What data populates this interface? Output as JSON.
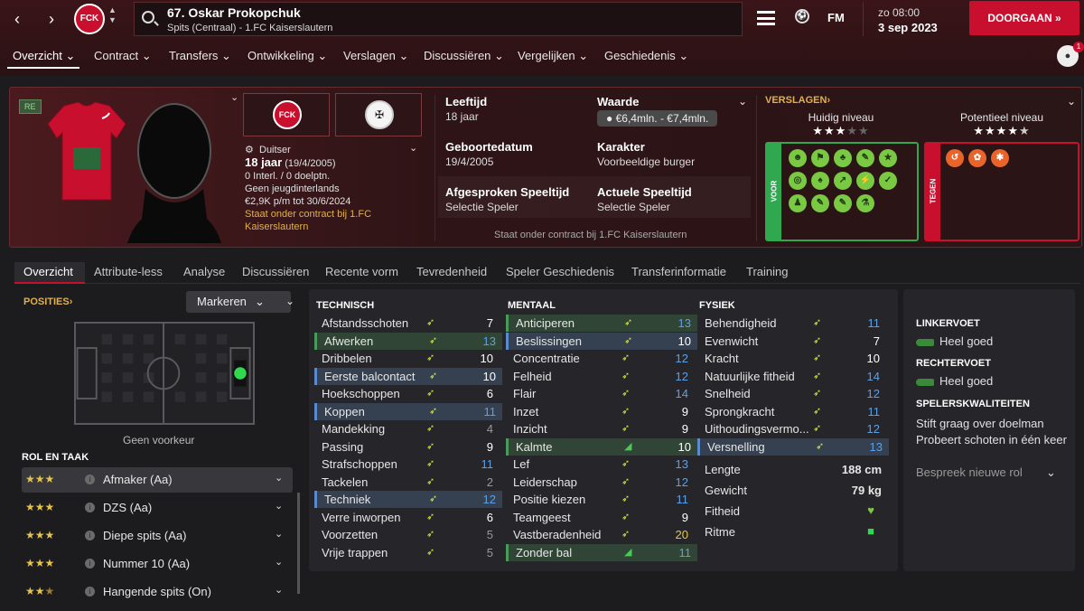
{
  "header": {
    "player_title": "67. Oskar Prokopchuk",
    "player_sub": "Spits (Centraal) - 1.FC Kaiserslautern",
    "club_badge": "FCK",
    "fm_label": "FM",
    "date_line1": "zo 08:00",
    "date_line2": "3 sep 2023",
    "continue_label": "DOORGAAN",
    "notif_count": "1"
  },
  "menu": [
    "Overzicht",
    "Contract",
    "Transfers",
    "Ontwikkeling",
    "Verslagen",
    "Discussiëren",
    "Vergelijken",
    "Geschiedenis"
  ],
  "hero": {
    "tag": "RE",
    "nationality": "Duitser",
    "age_line": "18 jaar",
    "dob_paren": "(19/4/2005)",
    "caps": "0 Interl. / 0 doelptn.",
    "youth": "Geen jeugdinterlands",
    "wage": "€2,9K p/m tot 30/6/2024",
    "contract_note": "Staat onder contract bij 1.FC Kaiserslautern",
    "leeftijd_k": "Leeftijd",
    "leeftijd_v": "18 jaar",
    "waarde_k": "Waarde",
    "waarde_v": "€6,4mln. - €7,4mln.",
    "geboorte_k": "Geboortedatum",
    "geboorte_v": "19/4/2005",
    "karakter_k": "Karakter",
    "karakter_v": "Voorbeeldige burger",
    "afgesproken_k": "Afgesproken Speeltijd",
    "afgesproken_v": "Selectie Speler",
    "actuele_k": "Actuele Speeltijd",
    "actuele_v": "Selectie Speler",
    "footer": "Staat onder contract bij 1.FC Kaiserslautern",
    "verslagen": "VERSLAGEN",
    "huidig": "Huidig niveau",
    "huidig_stars": 3,
    "potentieel": "Potentieel niveau",
    "potentieel_stars": 4.5,
    "voor": "VOOR",
    "tegen": "TEGEN"
  },
  "subtabs": [
    "Overzicht",
    "Attribute-less",
    "Analyse",
    "Discussiëren",
    "Recente vorm",
    "Tevredenheid",
    "Speler Geschiedenis",
    "Transferinformatie",
    "Training"
  ],
  "left": {
    "posities": "POSITIES",
    "markeren": "Markeren",
    "geen_voorkeur": "Geen voorkeur",
    "rol_en_taak": "ROL EN TAAK",
    "roles": [
      {
        "name": "Afmaker (Aa)",
        "stars": 3
      },
      {
        "name": "DZS (Aa)",
        "stars": 3
      },
      {
        "name": "Diepe spits (Aa)",
        "stars": 3
      },
      {
        "name": "Nummer 10 (Aa)",
        "stars": 3
      },
      {
        "name": "Hangende spits (On)",
        "stars": 2.5
      }
    ]
  },
  "attributes": {
    "technisch_label": "TECHNISCH",
    "mentaal_label": "MENTAAL",
    "fysiek_label": "FYSIEK",
    "technisch": [
      {
        "n": "Afstandsschoten",
        "v": 7,
        "h": ""
      },
      {
        "n": "Afwerken",
        "v": 13,
        "h": "g"
      },
      {
        "n": "Dribbelen",
        "v": 10,
        "h": ""
      },
      {
        "n": "Eerste balcontact",
        "v": 10,
        "h": "b"
      },
      {
        "n": "Hoekschoppen",
        "v": 6,
        "h": ""
      },
      {
        "n": "Koppen",
        "v": 11,
        "h": "b"
      },
      {
        "n": "Mandekking",
        "v": 4,
        "h": ""
      },
      {
        "n": "Passing",
        "v": 9,
        "h": ""
      },
      {
        "n": "Strafschoppen",
        "v": 11,
        "h": ""
      },
      {
        "n": "Tackelen",
        "v": 2,
        "h": ""
      },
      {
        "n": "Techniek",
        "v": 12,
        "h": "b"
      },
      {
        "n": "Verre inworpen",
        "v": 6,
        "h": ""
      },
      {
        "n": "Voorzetten",
        "v": 5,
        "h": ""
      },
      {
        "n": "Vrije trappen",
        "v": 5,
        "h": ""
      }
    ],
    "mentaal": [
      {
        "n": "Anticiperen",
        "v": 13,
        "h": "g"
      },
      {
        "n": "Beslissingen",
        "v": 10,
        "h": "b"
      },
      {
        "n": "Concentratie",
        "v": 12,
        "h": ""
      },
      {
        "n": "Felheid",
        "v": 12,
        "h": ""
      },
      {
        "n": "Flair",
        "v": 14,
        "h": ""
      },
      {
        "n": "Inzet",
        "v": 9,
        "h": ""
      },
      {
        "n": "Inzicht",
        "v": 9,
        "h": ""
      },
      {
        "n": "Kalmte",
        "v": 10,
        "h": "g"
      },
      {
        "n": "Lef",
        "v": 13,
        "h": ""
      },
      {
        "n": "Leiderschap",
        "v": 12,
        "h": ""
      },
      {
        "n": "Positie kiezen",
        "v": 11,
        "h": ""
      },
      {
        "n": "Teamgeest",
        "v": 9,
        "h": ""
      },
      {
        "n": "Vastberadenheid",
        "v": 20,
        "h": ""
      },
      {
        "n": "Zonder bal",
        "v": 11,
        "h": "g"
      }
    ],
    "fysiek": [
      {
        "n": "Behendigheid",
        "v": 11,
        "h": ""
      },
      {
        "n": "Evenwicht",
        "v": 7,
        "h": ""
      },
      {
        "n": "Kracht",
        "v": 10,
        "h": ""
      },
      {
        "n": "Natuurlijke fitheid",
        "v": 14,
        "h": ""
      },
      {
        "n": "Snelheid",
        "v": 12,
        "h": ""
      },
      {
        "n": "Sprongkracht",
        "v": 11,
        "h": ""
      },
      {
        "n": "Uithoudingsvermo...",
        "v": 12,
        "h": ""
      },
      {
        "n": "Versnelling",
        "v": 13,
        "h": "b"
      }
    ],
    "lengte_k": "Lengte",
    "lengte_v": "188 cm",
    "gewicht_k": "Gewicht",
    "gewicht_v": "79 kg",
    "fitheid_k": "Fitheid",
    "ritme_k": "Ritme"
  },
  "right": {
    "linkervoet_k": "LINKERVOET",
    "linkervoet_v": "Heel goed",
    "rechtervoet_k": "RECHTERVOET",
    "rechtervoet_v": "Heel goed",
    "kwal_k": "SPELERSKWALITEITEN",
    "kwal_1": "Stift graag over doelman",
    "kwal_2": "Probeert schoten in één keer",
    "bespreek": "Bespreek nieuwe rol"
  }
}
